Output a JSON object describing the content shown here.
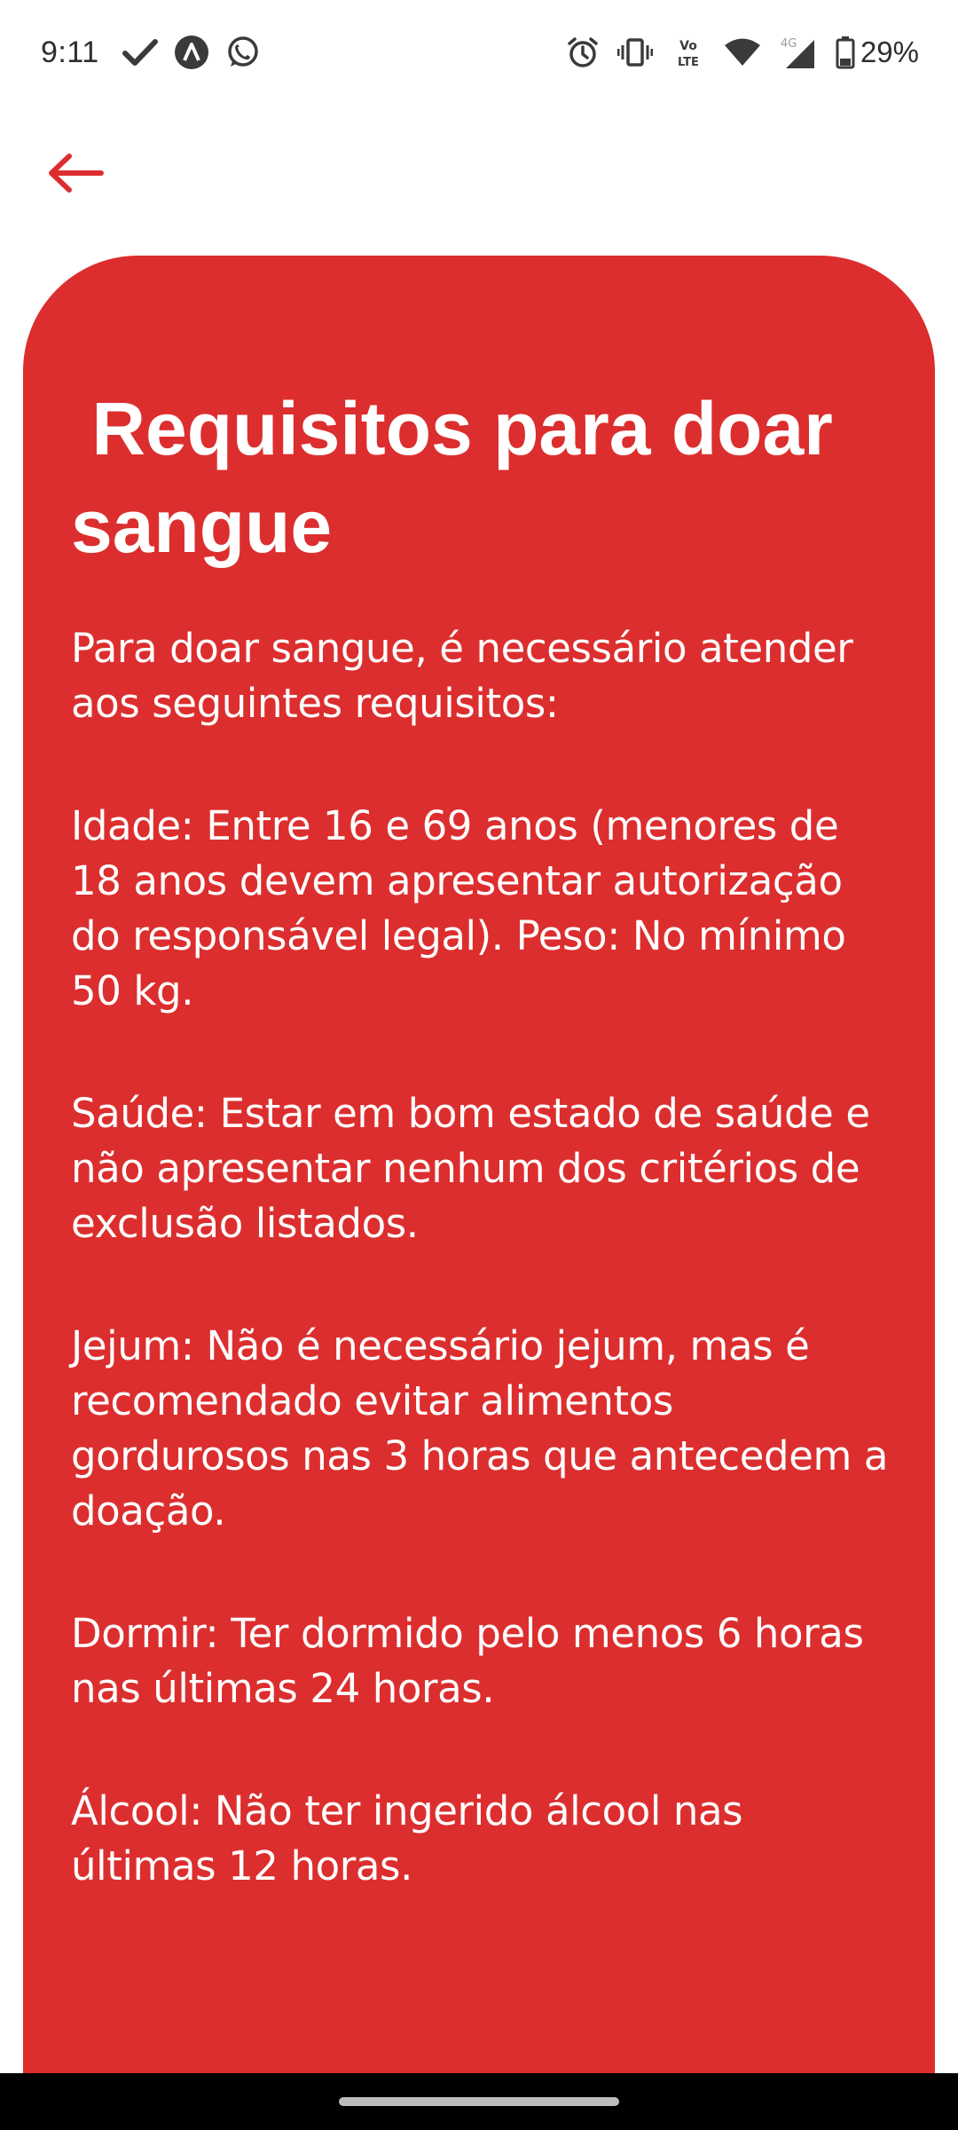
{
  "status_bar": {
    "time": "9:11",
    "battery_text": "29%",
    "left_icons": [
      "check-icon",
      "autonomo-app-icon",
      "whatsapp-icon"
    ],
    "right_icons": [
      "alarm-icon",
      "vibrate-icon",
      "volte-icon",
      "wifi-icon",
      "4g-signal-icon",
      "battery-icon"
    ]
  },
  "app_bar": {
    "back_icon": "arrow-left-icon",
    "accent_color": "#dc2e2e"
  },
  "card": {
    "background_color": "#dc2e2e",
    "title": " Requisitos para doar\nsangue",
    "paragraphs": [
      "Para doar sangue, é necessário atender aos seguintes requisitos:",
      "Idade: Entre 16 e 69 anos (menores de 18 anos devem apresentar autorização do responsável legal). Peso: No mínimo 50 kg.",
      "Saúde: Estar em bom estado de saúde e não apresentar nenhum dos critérios de exclusão listados.",
      "Jejum: Não é necessário jejum, mas é recomendado evitar alimentos gordurosos nas 3 horas que antecedem a doação.",
      "Dormir: Ter dormido pelo menos 6 horas nas últimas 24 horas.",
      "Álcool: Não ter ingerido álcool nas últimas 12 horas."
    ]
  }
}
